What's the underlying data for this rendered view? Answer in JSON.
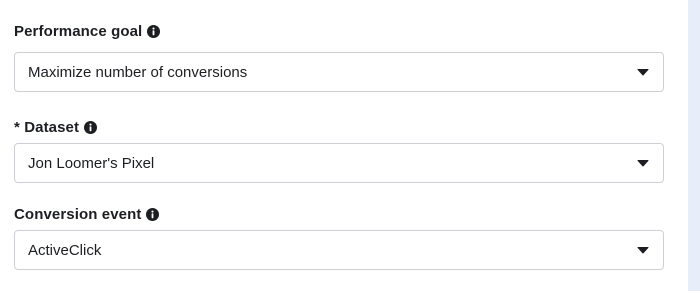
{
  "fields": [
    {
      "label": "Performance goal",
      "value": "Maximize number of conversions"
    },
    {
      "label": "* Dataset",
      "value": "Jon Loomer's Pixel"
    },
    {
      "label": "Conversion event",
      "value": "ActiveClick"
    }
  ],
  "icons": {
    "info": "info-icon",
    "dropdown": "caret-down-icon"
  },
  "colors": {
    "text": "#1c1e21",
    "border": "#ccd0d5",
    "side_strip": "#e8eef9"
  }
}
